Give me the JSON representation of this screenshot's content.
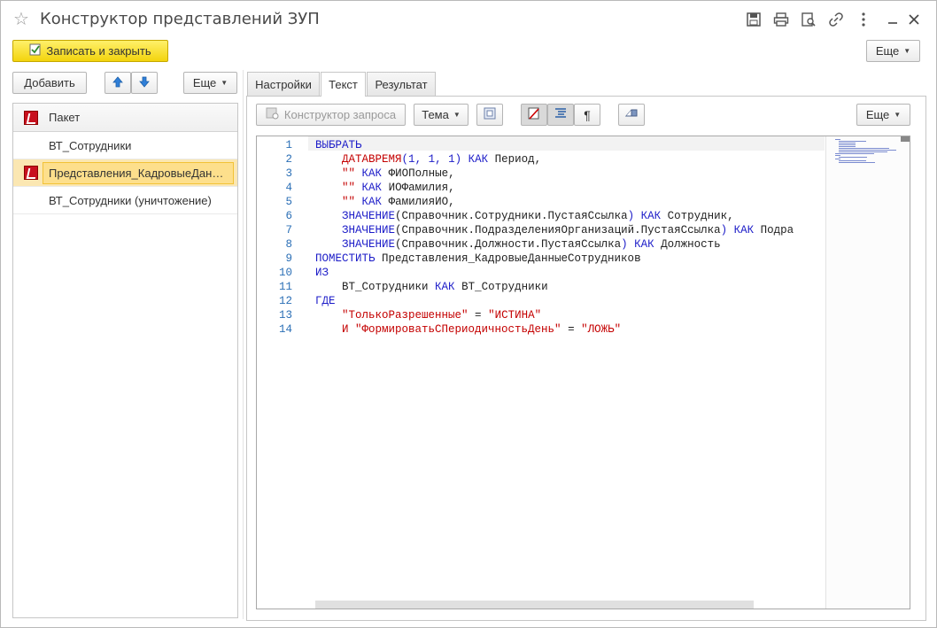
{
  "window": {
    "title": "Конструктор представлений ЗУП"
  },
  "toolbar": {
    "save_close_label": "Записать и закрыть",
    "more_label": "Еще"
  },
  "left": {
    "add_label": "Добавить",
    "more_label": "Еще",
    "column_header": "Пакет",
    "rows": [
      {
        "label": "ВТ_Сотрудники",
        "icon": false,
        "selected": false
      },
      {
        "label": "Представления_КадровыеДанн...",
        "icon": true,
        "selected": true
      },
      {
        "label": "ВТ_Сотрудники (уничтожение)",
        "icon": false,
        "selected": false
      }
    ]
  },
  "tabs": [
    {
      "label": "Настройки",
      "active": false
    },
    {
      "label": "Текст",
      "active": true
    },
    {
      "label": "Результат",
      "active": false
    }
  ],
  "editor_toolbar": {
    "query_builder_label": "Конструктор запроса",
    "theme_label": "Тема",
    "more_label": "Еще"
  },
  "code_lines": [
    {
      "n": "1",
      "tokens": [
        [
          "kw",
          "ВЫБРАТЬ"
        ]
      ]
    },
    {
      "n": "2",
      "tokens": [
        [
          "sp",
          "    "
        ],
        [
          "fn",
          "ДАТАВРЕМЯ"
        ],
        [
          "kw",
          "("
        ],
        [
          "num",
          "1"
        ],
        [
          "kw",
          ", "
        ],
        [
          "num",
          "1"
        ],
        [
          "kw",
          ", "
        ],
        [
          "num",
          "1"
        ],
        [
          "kw",
          ")"
        ],
        [
          "tx",
          " "
        ],
        [
          "kw",
          "КАК"
        ],
        [
          "tx",
          " Период,"
        ]
      ]
    },
    {
      "n": "3",
      "tokens": [
        [
          "sp",
          "    "
        ],
        [
          "str",
          "\"\""
        ],
        [
          "tx",
          " "
        ],
        [
          "kw",
          "КАК"
        ],
        [
          "tx",
          " ФИОПолные,"
        ]
      ]
    },
    {
      "n": "4",
      "tokens": [
        [
          "sp",
          "    "
        ],
        [
          "str",
          "\"\""
        ],
        [
          "tx",
          " "
        ],
        [
          "kw",
          "КАК"
        ],
        [
          "tx",
          " ИОФамилия,"
        ]
      ]
    },
    {
      "n": "5",
      "tokens": [
        [
          "sp",
          "    "
        ],
        [
          "str",
          "\"\""
        ],
        [
          "tx",
          " "
        ],
        [
          "kw",
          "КАК"
        ],
        [
          "tx",
          " ФамилияИО,"
        ]
      ]
    },
    {
      "n": "6",
      "tokens": [
        [
          "sp",
          "    "
        ],
        [
          "kw",
          "ЗНАЧЕНИЕ"
        ],
        [
          "tx",
          "(Справочник.Сотрудники.ПустаяСсылка"
        ],
        [
          "kw",
          ")"
        ],
        [
          "tx",
          " "
        ],
        [
          "kw",
          "КАК"
        ],
        [
          "tx",
          " Сотрудник,"
        ]
      ]
    },
    {
      "n": "7",
      "tokens": [
        [
          "sp",
          "    "
        ],
        [
          "kw",
          "ЗНАЧЕНИЕ"
        ],
        [
          "tx",
          "(Справочник.ПодразделенияОрганизаций.ПустаяСсылка"
        ],
        [
          "kw",
          ")"
        ],
        [
          "tx",
          " "
        ],
        [
          "kw",
          "КАК"
        ],
        [
          "tx",
          " Подра"
        ]
      ]
    },
    {
      "n": "8",
      "tokens": [
        [
          "sp",
          "    "
        ],
        [
          "kw",
          "ЗНАЧЕНИЕ"
        ],
        [
          "tx",
          "(Справочник.Должности.ПустаяСсылка"
        ],
        [
          "kw",
          ")"
        ],
        [
          "tx",
          " "
        ],
        [
          "kw",
          "КАК"
        ],
        [
          "tx",
          " Должность"
        ]
      ]
    },
    {
      "n": "9",
      "tokens": [
        [
          "kw",
          "ПОМЕСТИТЬ"
        ],
        [
          "tx",
          " Представления_КадровыеДанныеСотрудников"
        ]
      ]
    },
    {
      "n": "10",
      "tokens": [
        [
          "kw",
          "ИЗ"
        ]
      ]
    },
    {
      "n": "11",
      "tokens": [
        [
          "sp",
          "    "
        ],
        [
          "tx",
          "ВТ_Сотрудники "
        ],
        [
          "kw",
          "КАК"
        ],
        [
          "tx",
          " ВТ_Сотрудники"
        ]
      ]
    },
    {
      "n": "12",
      "tokens": [
        [
          "kw",
          "ГДЕ"
        ]
      ]
    },
    {
      "n": "13",
      "tokens": [
        [
          "sp",
          "    "
        ],
        [
          "str",
          "\"ТолькоРазрешенные\""
        ],
        [
          "tx",
          " = "
        ],
        [
          "str",
          "\"ИСТИНА\""
        ]
      ]
    },
    {
      "n": "14",
      "tokens": [
        [
          "sp",
          "    "
        ],
        [
          "str",
          "И \"ФормироватьСПериодичностьДень\""
        ],
        [
          "tx",
          " = "
        ],
        [
          "str",
          "\"ЛОЖЬ\""
        ]
      ]
    }
  ],
  "colors": {
    "keyword": "#1c1cc8",
    "function": "#c40000",
    "string": "#c40000",
    "line_number": "#2b6fb6",
    "save_button": "#f3d40d",
    "selection": "#fddf8c"
  }
}
